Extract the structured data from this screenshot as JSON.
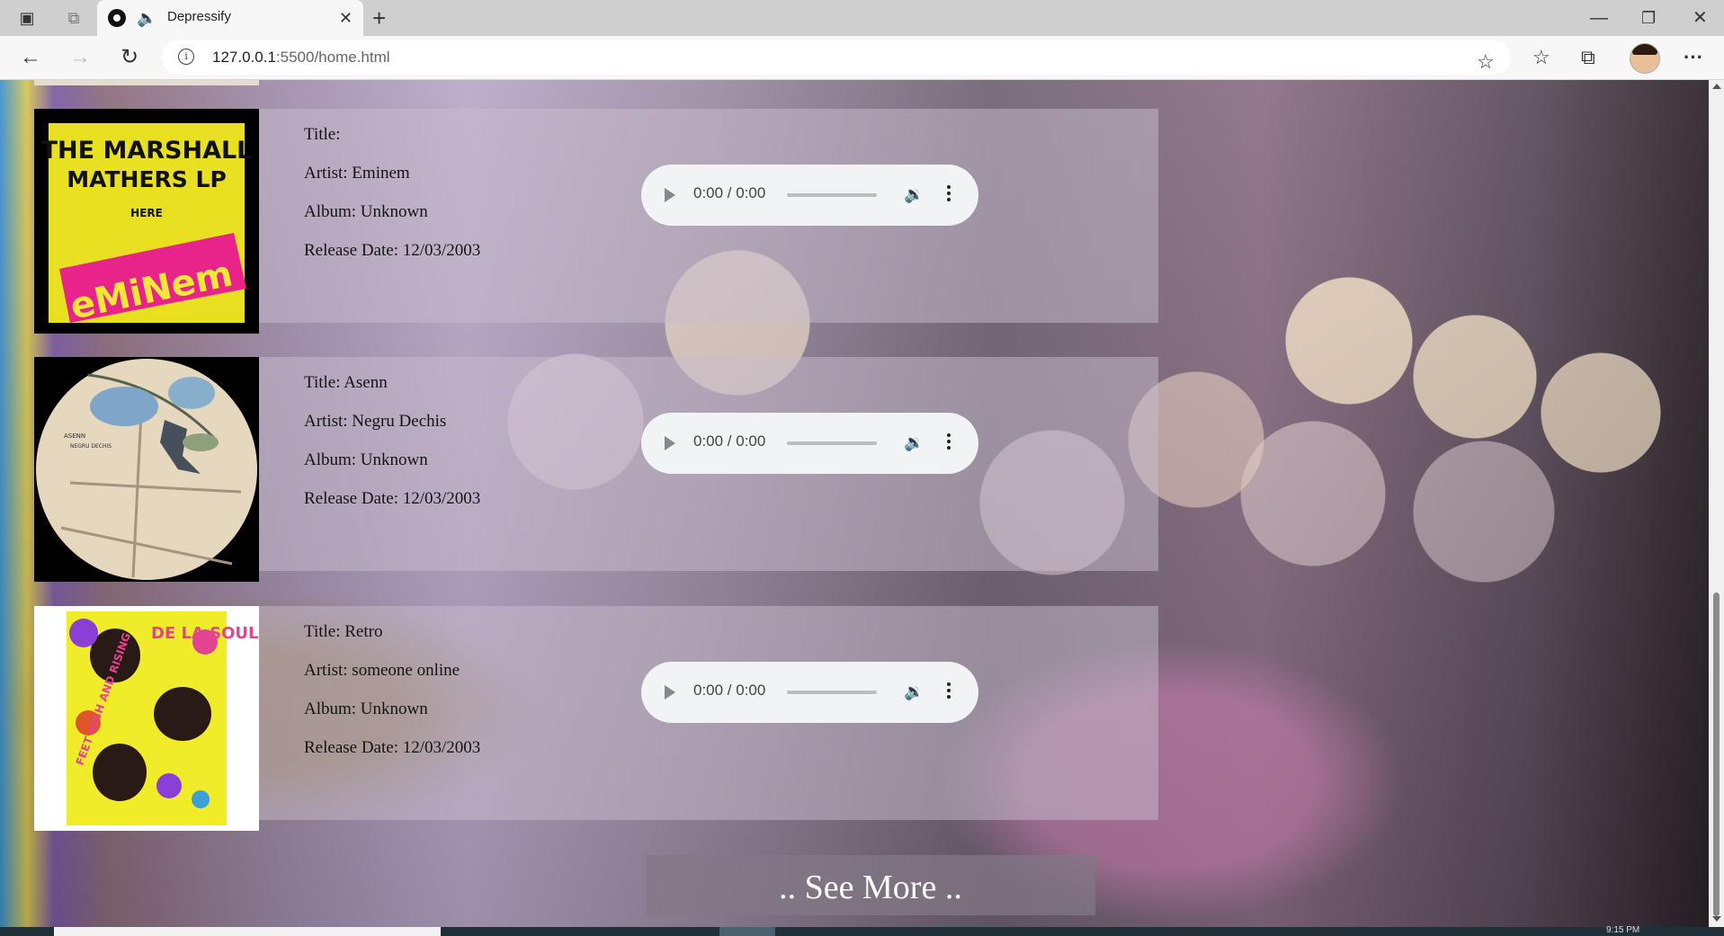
{
  "browser": {
    "tab_title": "Depressify",
    "url_host": "127.0.0.1",
    "url_rest": ":5500/home.html",
    "taskbar_time": "9:15 PM"
  },
  "songs": [
    {
      "cover": "The Marshall Mathers LP",
      "cover_text": {
        "line1": "THE MARSHALL",
        "line2": "MATHERS LP",
        "line3": "HERE",
        "logo": "eMiNem"
      },
      "title": "Title: ",
      "artist": "Artist: Eminem",
      "album": "Album: Unknown",
      "release": "Release Date: 12/03/2003",
      "player_time": "0:00 / 0:00"
    },
    {
      "cover": "Asenn - Negru Dechis",
      "cover_text": {
        "line1": "ASENN",
        "line2": "NEGRU DECHIS"
      },
      "title": "Title: Asenn",
      "artist": "Artist: Negru Dechis",
      "album": "Album: Unknown",
      "release": "Release Date: 12/03/2003",
      "player_time": "0:00 / 0:00"
    },
    {
      "cover": "3 Feet High and Rising - De La Soul",
      "cover_text": {
        "line1": "DE LA SOUL",
        "line2": "FEET HIGH AND RISING"
      },
      "title": "Title: Retro",
      "artist": "Artist: someone online",
      "album": "Album: Unknown",
      "release": "Release Date: 12/03/2003",
      "player_time": "0:00 / 0:00"
    }
  ],
  "see_more_label": ".. See More .."
}
